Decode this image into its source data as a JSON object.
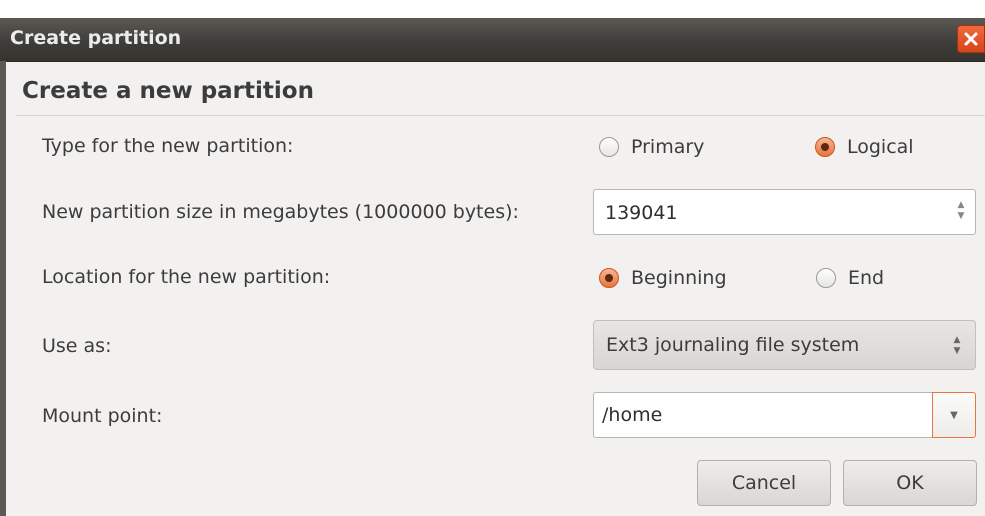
{
  "window": {
    "title": "Create partition",
    "close_icon": "close-icon"
  },
  "form": {
    "heading": "Create a new partition",
    "type": {
      "label": "Type for the new partition:",
      "options": [
        {
          "label": "Primary",
          "checked": false
        },
        {
          "label": "Logical",
          "checked": true
        }
      ]
    },
    "size": {
      "label": "New partition size in megabytes (1000000 bytes):",
      "value": "139041"
    },
    "location": {
      "label": "Location for the new partition:",
      "options": [
        {
          "label": "Beginning",
          "checked": true
        },
        {
          "label": "End",
          "checked": false
        }
      ]
    },
    "use_as": {
      "label": "Use as:",
      "value": "Ext3 journaling file system"
    },
    "mount_point": {
      "label": "Mount point:",
      "value": "/home"
    }
  },
  "buttons": {
    "cancel": "Cancel",
    "ok": "OK"
  },
  "colors": {
    "titlebar": "#3d3c38",
    "accent": "#e8743f",
    "close": "#e0532a",
    "dialog_bg": "#f2f1f0"
  }
}
